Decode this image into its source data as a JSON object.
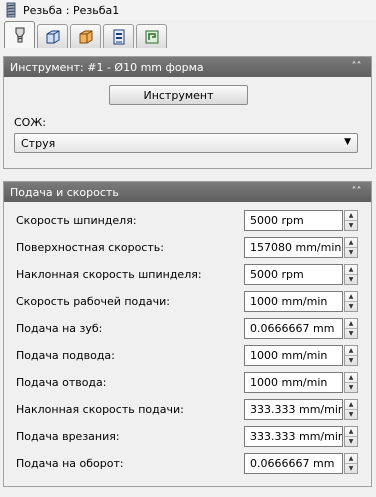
{
  "window": {
    "title": "Резьба : Резьба1"
  },
  "tabs": [
    {
      "icon": "tool-icon",
      "active": true
    },
    {
      "icon": "cube-icon",
      "active": false
    },
    {
      "icon": "orange-cube-icon",
      "active": false
    },
    {
      "icon": "layers-icon",
      "active": false
    },
    {
      "icon": "linking-icon",
      "active": false
    }
  ],
  "tool_section": {
    "header": "Инструмент: #1 - Ø10 mm форма",
    "button_label": "Инструмент",
    "coolant_label": "СОЖ:",
    "coolant_value": "Струя"
  },
  "feed_section": {
    "header": "Подача и скорость",
    "rows": [
      {
        "label": "Скорость шпинделя:",
        "value": "5000 rpm"
      },
      {
        "label": "Поверхностная скорость:",
        "value": "157080 mm/min"
      },
      {
        "label": "Наклонная скорость шпинделя:",
        "value": "5000 rpm"
      },
      {
        "label": "Скорость рабочей подачи:",
        "value": "1000 mm/min"
      },
      {
        "label": "Подача на зуб:",
        "value": "0.0666667 mm"
      },
      {
        "label": "Подача подвода:",
        "value": "1000 mm/min"
      },
      {
        "label": "Подача отвода:",
        "value": "1000 mm/min"
      },
      {
        "label": "Наклонная скорость подачи:",
        "value": "333.333 mm/min"
      },
      {
        "label": "Подача врезания:",
        "value": "333.333 mm/min"
      },
      {
        "label": "Подача на оборот:",
        "value": "0.0666667 mm"
      }
    ]
  }
}
